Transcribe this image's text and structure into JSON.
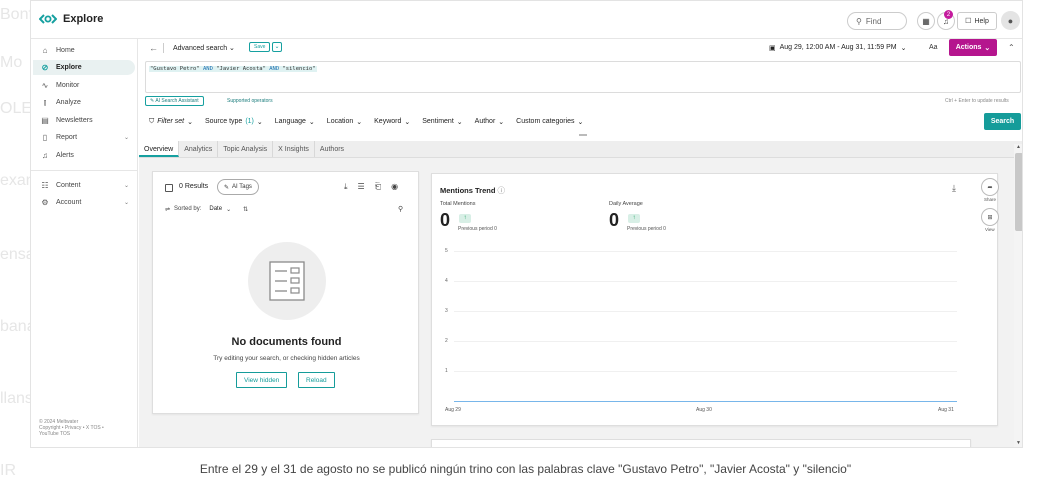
{
  "app": {
    "title": "Explore",
    "brand_color": "#16a0a0",
    "accent_color": "#b5158e"
  },
  "topbar": {
    "find_label": "Find",
    "notification_count": "2",
    "help_label": "Help"
  },
  "sidebar": {
    "items": [
      {
        "label": "Home",
        "icon": "home-icon"
      },
      {
        "label": "Explore",
        "icon": "compass-icon"
      },
      {
        "label": "Monitor",
        "icon": "pulse-icon"
      },
      {
        "label": "Analyze",
        "icon": "bar-chart-icon"
      },
      {
        "label": "Newsletters",
        "icon": "newsletter-icon"
      },
      {
        "label": "Report",
        "icon": "report-icon"
      },
      {
        "label": "Alerts",
        "icon": "bell-icon"
      },
      {
        "label": "Content",
        "icon": "content-icon"
      },
      {
        "label": "Account",
        "icon": "gear-icon"
      }
    ],
    "footer_line1": "© 2024 Meltwater",
    "footer_line2": "Copyright • Privacy • X TOS •",
    "footer_line3": "YouTube TOS"
  },
  "query": {
    "title": "Advanced search",
    "save_label": "Save",
    "date_range": "Aug 29, 12:00 AM - Aug 31, 11:59 PM",
    "aa_label": "Aa",
    "actions_label": "Actions",
    "term1": "\"Gustavo Petro\"",
    "op1": "AND",
    "term2": "\"Javier Acosta\"",
    "op2": "AND",
    "term3": "\"silencio\"",
    "ai_assistant_label": "AI Search Assistant",
    "supported_operators_label": "Supported operators",
    "hint": "Ctrl + Enter to update results",
    "search_label": "Search"
  },
  "filters": {
    "filter_set": "Filter set",
    "source_type": "Source type",
    "source_type_count": "(1)",
    "language": "Language",
    "location": "Location",
    "keyword": "Keyword",
    "sentiment": "Sentiment",
    "author": "Author",
    "custom_categories": "Custom categories"
  },
  "tabs": [
    "Overview",
    "Analytics",
    "Topic Analysis",
    "X Insights",
    "Authors"
  ],
  "results": {
    "count_label": "0 Results",
    "ai_tags_label": "AI Tags",
    "sorted_by_label": "Sorted by:",
    "sorted_by_value": "Date",
    "empty_title": "No documents found",
    "empty_subtitle": "Try editing your search, or checking hidden articles",
    "view_hidden_label": "View hidden",
    "reload_label": "Reload"
  },
  "trend": {
    "title": "Mentions Trend",
    "total_label": "Total Mentions",
    "total_value": "0",
    "total_prev": "Previous period 0",
    "daily_label": "Daily Average",
    "daily_value": "0",
    "daily_prev": "Previous period 0",
    "y_ticks": [
      "5",
      "4",
      "3",
      "2",
      "1"
    ],
    "x_ticks": [
      "Aug 29",
      "Aug 30",
      "Aug 31"
    ]
  },
  "rail": {
    "share_label": "Share",
    "view_label": "View"
  },
  "caption": "Entre el 29 y el 31 de agosto no se publicó ningún trino con las palabras clave \"Gustavo Petro\", \"Javier Acosta\" y \"silencio\""
}
